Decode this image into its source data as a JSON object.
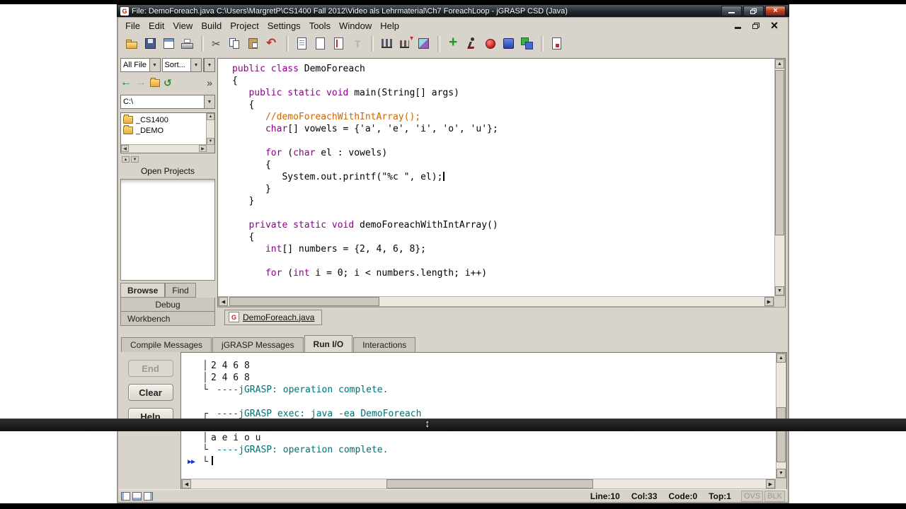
{
  "window": {
    "app_icon_letter": "G",
    "title": "File: DemoForeach.java  C:\\Users\\MargretP\\CS1400 Fall 2012\\Video als Lehrmaterial\\Ch7 ForeachLoop - jGRASP CSD (Java)"
  },
  "menu": {
    "items": [
      "File",
      "Edit",
      "View",
      "Build",
      "Project",
      "Settings",
      "Tools",
      "Window",
      "Help"
    ]
  },
  "toolbar": {
    "groups": [
      [
        "open",
        "save",
        "file-browser",
        "print"
      ],
      [
        "cut",
        "copy",
        "paste",
        "undo"
      ],
      [
        "generate-csd",
        "remove-csd",
        "number-lines",
        "freeze"
      ],
      [
        "complexity-graph",
        "profile-graph",
        "uml"
      ],
      [
        "compile",
        "run",
        "debug",
        "break",
        "workbench"
      ],
      [
        "run-io"
      ]
    ]
  },
  "sidebar": {
    "filter_value": "All File",
    "sort_value": "Sort...",
    "path_value": "C:\\",
    "folders": [
      "_CS1400",
      "_DEMO"
    ],
    "open_projects_label": "Open Projects",
    "tabs_row": [
      "Browse",
      "Find"
    ],
    "active_tab": "Browse",
    "stacked_tabs": [
      "Debug",
      "Workbench"
    ]
  },
  "editor": {
    "lines": [
      [
        {
          "t": "public class ",
          "c": "k"
        },
        {
          "t": "DemoForeach",
          "c": "p"
        }
      ],
      [
        {
          "t": "{",
          "c": "p"
        }
      ],
      [
        {
          "t": "   ",
          "c": "p"
        },
        {
          "t": "public static void ",
          "c": "k"
        },
        {
          "t": "main(String[] args)",
          "c": "p"
        }
      ],
      [
        {
          "t": "   {",
          "c": "p"
        }
      ],
      [
        {
          "t": "      ",
          "c": "p"
        },
        {
          "t": "//demoForeachWithIntArray();",
          "c": "m"
        }
      ],
      [
        {
          "t": "      ",
          "c": "p"
        },
        {
          "t": "char",
          "c": "k"
        },
        {
          "t": "[] vowels = {'a', 'e', 'i', 'o', 'u'};",
          "c": "p"
        }
      ],
      [],
      [
        {
          "t": "      ",
          "c": "p"
        },
        {
          "t": "for",
          "c": "k"
        },
        {
          "t": " (",
          "c": "p"
        },
        {
          "t": "char",
          "c": "k"
        },
        {
          "t": " el : vowels)",
          "c": "p"
        }
      ],
      [
        {
          "t": "      {",
          "c": "p"
        }
      ],
      [
        {
          "t": "         System.out.printf(\"%c \", el);",
          "c": "p"
        },
        {
          "t": "",
          "c": "caret"
        }
      ],
      [
        {
          "t": "      }",
          "c": "p"
        }
      ],
      [
        {
          "t": "   }",
          "c": "p"
        }
      ],
      [],
      [
        {
          "t": "   ",
          "c": "p"
        },
        {
          "t": "private static void ",
          "c": "k"
        },
        {
          "t": "demoForeachWithIntArray()",
          "c": "p"
        }
      ],
      [
        {
          "t": "   {",
          "c": "p"
        }
      ],
      [
        {
          "t": "      ",
          "c": "p"
        },
        {
          "t": "int",
          "c": "k"
        },
        {
          "t": "[] numbers = {2, 4, 6, 8};",
          "c": "p"
        }
      ],
      [],
      [
        {
          "t": "      ",
          "c": "p"
        },
        {
          "t": "for",
          "c": "k"
        },
        {
          "t": " (",
          "c": "p"
        },
        {
          "t": "int",
          "c": "k"
        },
        {
          "t": " i = 0; i < numbers.length; i++)",
          "c": "p"
        }
      ]
    ]
  },
  "file_tab": {
    "icon_letter": "G",
    "label": "DemoForeach.java"
  },
  "bottom": {
    "tabs": [
      "Compile Messages",
      "jGRASP Messages",
      "Run I/O",
      "Interactions"
    ],
    "active_tab": "Run I/O",
    "buttons": [
      {
        "label": "End",
        "disabled": true
      },
      {
        "label": "Clear",
        "disabled": false
      },
      {
        "label": "Help",
        "disabled": false
      }
    ],
    "output": {
      "lines": [
        {
          "marker": "",
          "prefix": "│",
          "text": "2 4 6 8",
          "type": "out"
        },
        {
          "marker": "",
          "prefix": "│",
          "text": "2 4 6 8",
          "type": "out"
        },
        {
          "marker": "",
          "prefix": "└",
          "text": " ----jGRASP: operation complete.",
          "type": "msg"
        },
        {
          "marker": "",
          "prefix": "",
          "text": "",
          "type": "out"
        },
        {
          "marker": "",
          "prefix": "┌",
          "text": " ----jGRASP exec: java -ea DemoForeach",
          "type": "msg"
        },
        {
          "marker": "",
          "prefix": "│",
          "text": "",
          "type": "out"
        },
        {
          "marker": "",
          "prefix": "│",
          "text": "a e i o u",
          "type": "out"
        },
        {
          "marker": "",
          "prefix": "└",
          "text": " ----jGRASP: operation complete.",
          "type": "msg"
        },
        {
          "marker": "▶▶",
          "prefix": "└",
          "text": "",
          "type": "prompt"
        }
      ]
    }
  },
  "status": {
    "fields": [
      "Line:10",
      "Col:33",
      "Code:0",
      "Top:1"
    ],
    "toggles": [
      "OVS",
      "BLK"
    ]
  },
  "colors": {
    "keyword": "#8b008b",
    "comment": "#cc6600",
    "jgrasp_message": "#007070",
    "chrome": "#d8d4cb"
  }
}
